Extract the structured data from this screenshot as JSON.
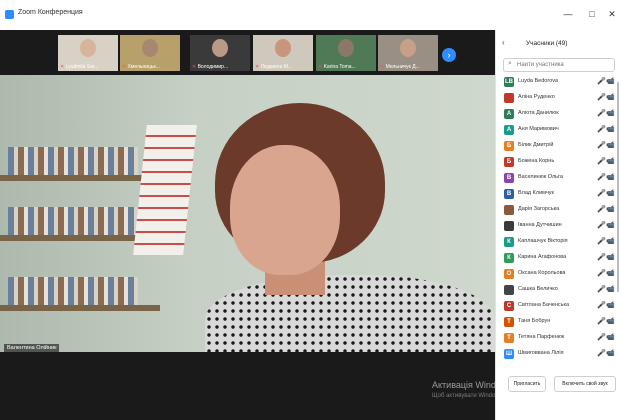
{
  "app": {
    "title": "Zoom Конференция",
    "minimize": "—",
    "maximize": "□",
    "close": "✕"
  },
  "thumbnails": [
    {
      "name": "Lyudmila Sar..."
    },
    {
      "name": "Хмельницьк..."
    },
    {
      "name": "Володимир..."
    },
    {
      "name": "Людмила М..."
    },
    {
      "name": "Karina Toma..."
    },
    {
      "name": "Мельничук Д..."
    }
  ],
  "strip_next_icon": "›",
  "main_video": {
    "speaker_name": "Валентина Олійник"
  },
  "watermark": {
    "line1": "Активація Windows",
    "line2": "Щоб активувати Windows, перейдіть до"
  },
  "panel": {
    "back_icon": "‹",
    "title": "Учасники (49)",
    "search_placeholder": "Найти участника",
    "search_icon": "⌕",
    "mic_off_icon": "🎤",
    "cam_off_icon": "📹",
    "participants": [
      {
        "initials": "LB",
        "name": "Luyda Bedorova",
        "color": "#2e7d5b"
      },
      {
        "initials": "",
        "name": "Аліна Руденко",
        "color": "#c0392b"
      },
      {
        "initials": "А",
        "name": "Аліота Данилюк",
        "color": "#2e7d5b"
      },
      {
        "initials": "А",
        "name": "Аня Маримович",
        "color": "#1a9c8c"
      },
      {
        "initials": "Б",
        "name": "Білик Дмитрій",
        "color": "#e67e22"
      },
      {
        "initials": "Б",
        "name": "Божена Корнь",
        "color": "#c0392b"
      },
      {
        "initials": "В",
        "name": "Васелинюк Ольга",
        "color": "#8e44ad"
      },
      {
        "initials": "В",
        "name": "Влад Климчук",
        "color": "#2d5fa8"
      },
      {
        "initials": "",
        "name": "Дарія Загорська",
        "color": "#8b5a3c"
      },
      {
        "initials": "",
        "name": "Іванна Дутчишин",
        "color": "#3a3a3a"
      },
      {
        "initials": "К",
        "name": "Каплашчук Вікторія",
        "color": "#1a9c8c"
      },
      {
        "initials": "К",
        "name": "Карина Агафонова",
        "color": "#2e9c5b"
      },
      {
        "initials": "О",
        "name": "Оксана Корольова",
        "color": "#e67e22"
      },
      {
        "initials": "",
        "name": "Сашка Величко",
        "color": "#444444"
      },
      {
        "initials": "С",
        "name": "Світлана Баченська",
        "color": "#c0392b"
      },
      {
        "initials": "Т",
        "name": "Таня Бобрун",
        "color": "#d35400"
      },
      {
        "initials": "Т",
        "name": "Тетяна Парфенюк",
        "color": "#e67e22"
      },
      {
        "initials": "Ш",
        "name": "Шмиговвана Лілія",
        "color": "#2d8cff"
      }
    ],
    "invite_label": "Пригласить",
    "unmute_label": "Включить свой звук"
  }
}
